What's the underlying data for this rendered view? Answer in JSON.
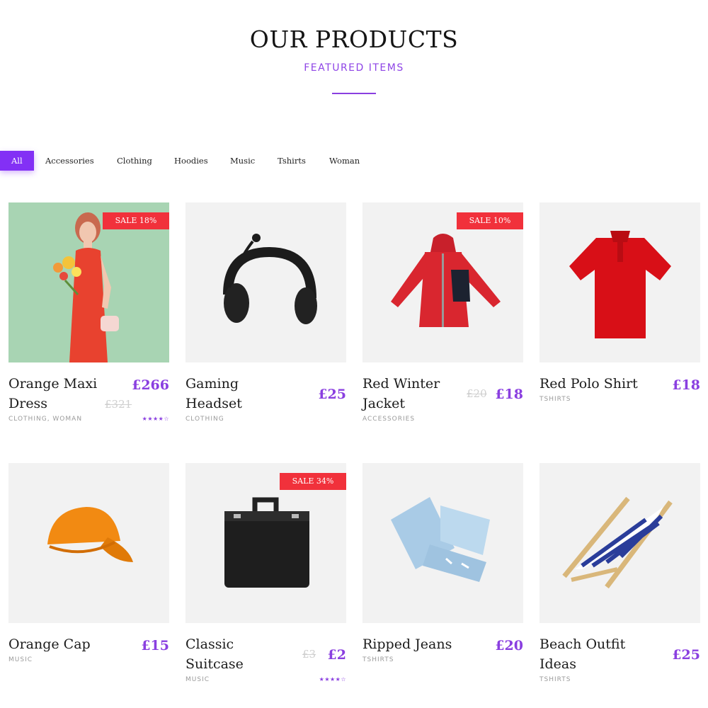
{
  "header": {
    "title": "OUR PRODUCTS",
    "subtitle": "FEATURED ITEMS"
  },
  "filters": [
    "All",
    "Accessories",
    "Clothing",
    "Hoodies",
    "Music",
    "Tshirts",
    "Woman"
  ],
  "active_filter": "All",
  "colors": {
    "accent": "#8330f5",
    "sale": "#f1313b",
    "price": "#8a3fe0"
  },
  "products": [
    {
      "name": "Orange Maxi Dress",
      "name_l1": "Orange Maxi",
      "name_l2": "Dress",
      "price": "£266",
      "old_price": "£321",
      "categories": "CLOTHING, WOMAN",
      "sale": "SALE 18%",
      "rating": "★★★★☆",
      "rating_value": 4,
      "image": "woman-with-flowers-photo"
    },
    {
      "name": "Gaming Headset",
      "name_l1": "Gaming",
      "name_l2": "Headset",
      "price": "£25",
      "categories": "CLOTHING",
      "image": "headset-photo"
    },
    {
      "name": "Red Winter Jacket",
      "name_l1": "Red Winter",
      "name_l2": "Jacket",
      "price": "£18",
      "old_price": "£20",
      "categories": "ACCESSORIES",
      "sale": "SALE 10%",
      "image": "jacket-photo"
    },
    {
      "name": "Red Polo Shirt",
      "name_l1": "Red Polo Shirt",
      "price": "£18",
      "categories": "TSHIRTS",
      "image": "polo-shirt-photo"
    },
    {
      "name": "Orange Cap",
      "name_l1": "Orange Cap",
      "price": "£15",
      "categories": "MUSIC",
      "image": "cap-photo"
    },
    {
      "name": "Classic Suitcase",
      "name_l1": "Classic",
      "name_l2": "Suitcase",
      "price": "£2",
      "old_price": "£3",
      "categories": "MUSIC",
      "sale": "SALE 34%",
      "rating": "★★★★☆",
      "rating_value": 4,
      "image": "suitcase-photo"
    },
    {
      "name": "Ripped Jeans",
      "name_l1": "Ripped Jeans",
      "price": "£20",
      "categories": "TSHIRTS",
      "image": "jeans-photo"
    },
    {
      "name": "Beach Outfit Ideas",
      "name_l1": "Beach Outfit",
      "name_l2": "Ideas",
      "price": "£25",
      "categories": "TSHIRTS",
      "image": "beach-chair-photo"
    }
  ]
}
